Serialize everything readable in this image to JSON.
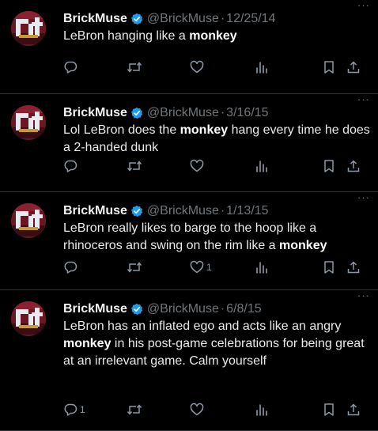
{
  "colors": {
    "background": "#000000",
    "text": "#e7e9ea",
    "muted": "#71767b",
    "verified": "#1d9bf0",
    "divider": "#2f3336"
  },
  "icons": [
    "reply-icon",
    "retweet-icon",
    "like-icon",
    "views-icon",
    "bookmark-icon",
    "share-icon",
    "verified-badge-icon",
    "more-options-icon"
  ],
  "tweets": [
    {
      "name": "BrickMuse",
      "handle": "@BrickMuse",
      "separator": "·",
      "date": "12/25/14",
      "text_before": "LeBron hanging like a ",
      "highlight": "monkey",
      "text_after": "",
      "reply_count": "",
      "like_count": ""
    },
    {
      "name": "BrickMuse",
      "handle": "@BrickMuse",
      "separator": "·",
      "date": "3/16/15",
      "text_before": "Lol LeBron does the ",
      "highlight": "monkey",
      "text_after": " hang every time he does a 2-handed dunk",
      "reply_count": "",
      "like_count": ""
    },
    {
      "name": "BrickMuse",
      "handle": "@BrickMuse",
      "separator": "·",
      "date": "1/13/15",
      "text_before": "LeBron really likes to barge to the hoop like a rhinoceros and swing on the rim like a ",
      "highlight": "monkey",
      "text_after": "",
      "reply_count": "",
      "like_count": "1"
    },
    {
      "name": "BrickMuse",
      "handle": "@BrickMuse",
      "separator": "·",
      "date": "6/8/15",
      "text_before": "LeBron has an inflated ego and acts like an angry ",
      "highlight": "monkey",
      "text_after": " in his post-game celebrations for being great at an irrelevant game. Calm yourself",
      "reply_count": "1",
      "like_count": ""
    }
  ]
}
